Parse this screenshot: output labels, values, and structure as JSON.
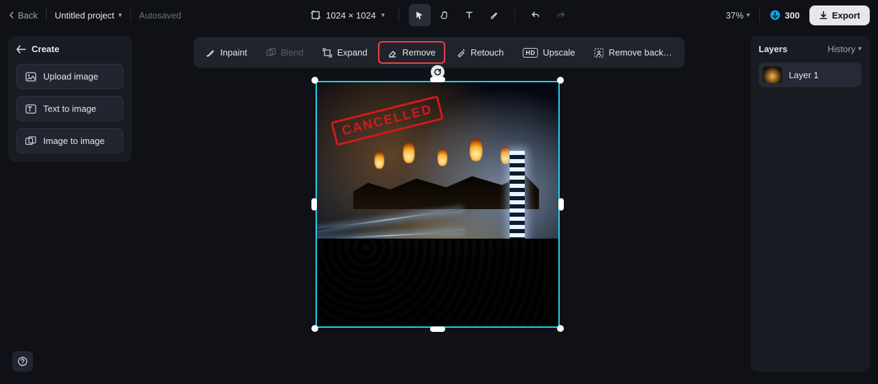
{
  "topbar": {
    "back_label": "Back",
    "project_name": "Untitled project",
    "autosaved_label": "Autosaved",
    "dimensions": "1024 × 1024",
    "zoom": "37%",
    "credits": "300",
    "export_label": "Export"
  },
  "sidebar": {
    "create_label": "Create",
    "upload_label": "Upload image",
    "text_to_image_label": "Text to image",
    "image_to_image_label": "Image to image"
  },
  "actions": {
    "inpaint": "Inpaint",
    "blend": "Blend",
    "expand": "Expand",
    "remove": "Remove",
    "retouch": "Retouch",
    "upscale": "Upscale",
    "remove_bg": "Remove back…"
  },
  "canvas": {
    "stamp_text": "CANCELLED"
  },
  "layers": {
    "title": "Layers",
    "history_label": "History",
    "items": [
      {
        "label": "Layer 1"
      }
    ]
  },
  "colors": {
    "selection_border": "#22d3ee",
    "highlight": "#ef4444",
    "credit_accent": "#38bdf8"
  }
}
